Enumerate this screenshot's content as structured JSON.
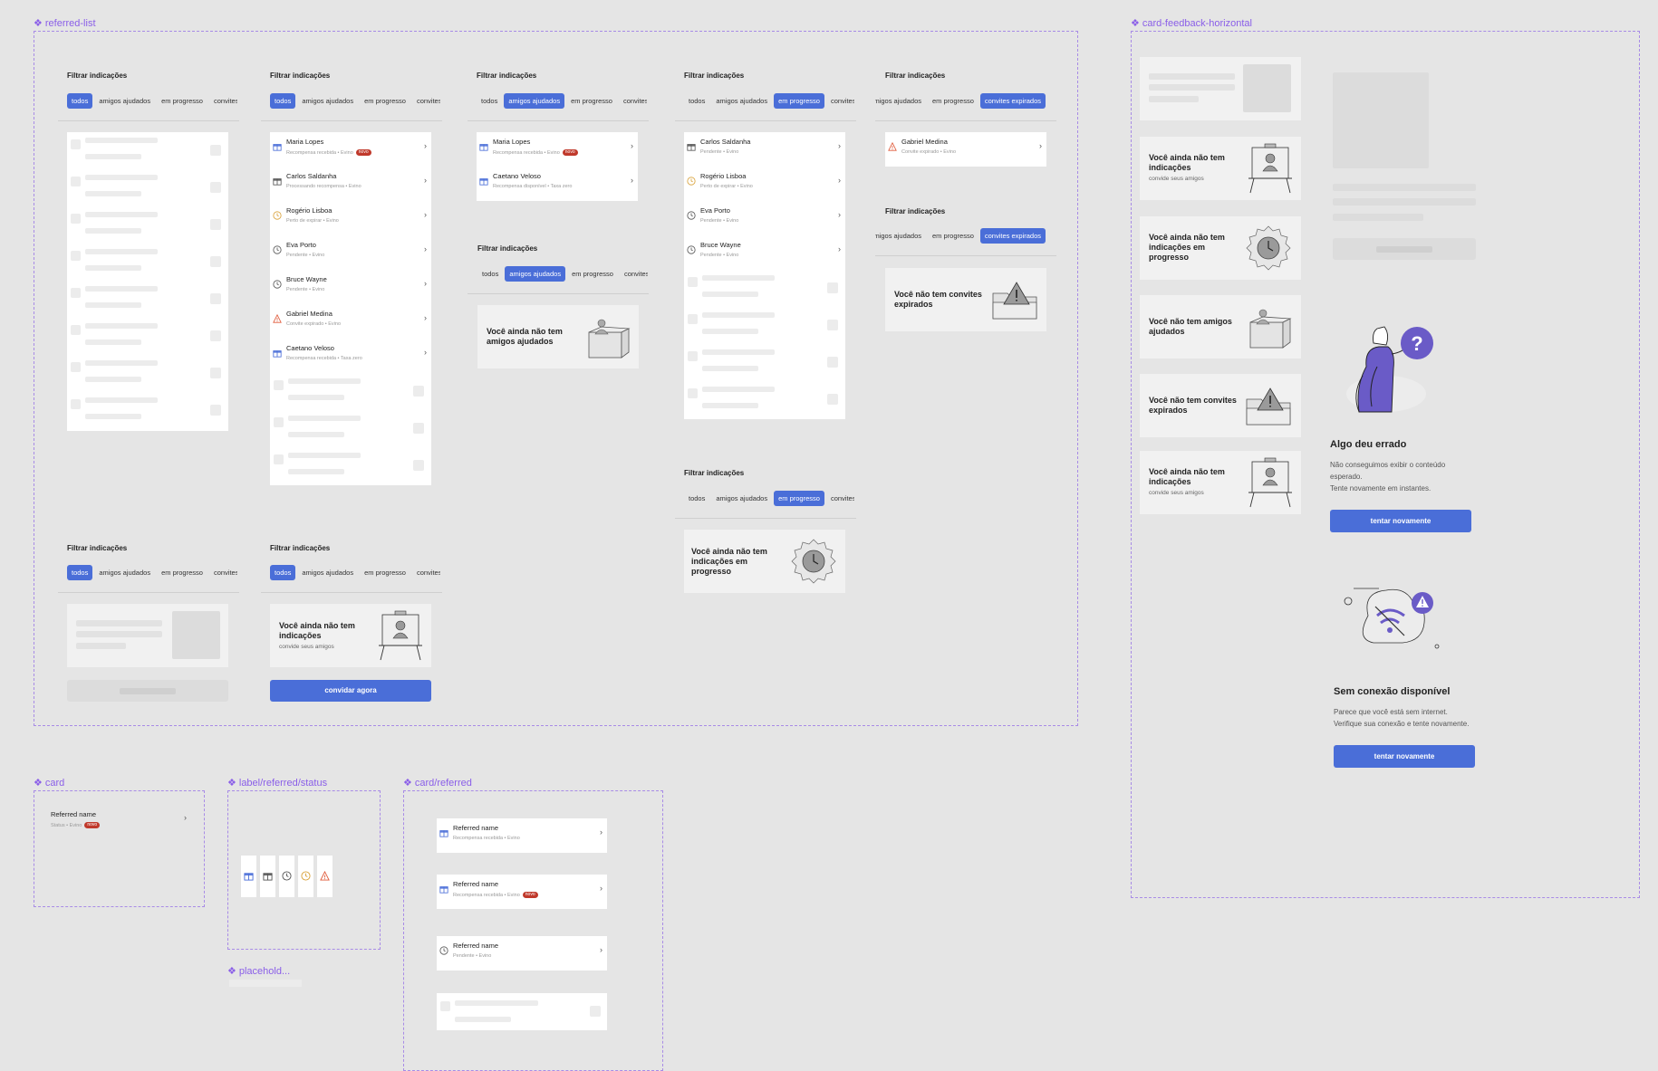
{
  "frames": {
    "referred_list": "referred-list",
    "card_feedback": "card-feedback-horizontal",
    "card": "card",
    "label_status": "label/referred/status",
    "placeholder": "placehold...",
    "card_referred": "card/referred"
  },
  "filter_header": "Filtrar indicações",
  "chips": {
    "todos": "todos",
    "amigos": "amigos ajudados",
    "progresso": "em progresso",
    "convites": "convites expirados",
    "convites_cut": "convites e",
    "amigos_cut": "amigos ajudados"
  },
  "badge": "novo",
  "list_todos": [
    {
      "name": "Maria Lopes",
      "sub": "Recompensa recebida • Evino",
      "badge": true,
      "icon": "gift-blue"
    },
    {
      "name": "Carlos Saldanha",
      "sub": "Processando recompensa • Evino",
      "badge": false,
      "icon": "gift-grey"
    },
    {
      "name": "Rogério Lisboa",
      "sub": "Perto de expirar • Evino",
      "badge": false,
      "icon": "clock-orange"
    },
    {
      "name": "Eva Porto",
      "sub": "Pendente • Evino",
      "badge": false,
      "icon": "clock"
    },
    {
      "name": "Bruce Wayne",
      "sub": "Pendente • Evino",
      "badge": false,
      "icon": "clock"
    },
    {
      "name": "Gabriel Medina",
      "sub": "Convite expirado • Evino",
      "badge": false,
      "icon": "warning"
    },
    {
      "name": "Caetano Veloso",
      "sub": "Recompensa recebida • Taxa zero",
      "badge": false,
      "icon": "gift-blue"
    }
  ],
  "list_amigos": [
    {
      "name": "Maria Lopes",
      "sub": "Recompensa recebida • Evino",
      "badge": true,
      "icon": "gift-blue"
    },
    {
      "name": "Caetano Veloso",
      "sub": "Recompensa disponível • Taxa zero",
      "badge": false,
      "icon": "gift-blue"
    }
  ],
  "list_progresso": [
    {
      "name": "Carlos Saldanha",
      "sub": "Pendente • Evino",
      "badge": false,
      "icon": "gift-grey"
    },
    {
      "name": "Rogério Lisboa",
      "sub": "Perto de expirar • Evino",
      "badge": false,
      "icon": "clock-orange"
    },
    {
      "name": "Eva Porto",
      "sub": "Pendente • Evino",
      "badge": false,
      "icon": "clock"
    },
    {
      "name": "Bruce Wayne",
      "sub": "Pendente • Evino",
      "badge": false,
      "icon": "clock"
    }
  ],
  "list_expirados": [
    {
      "name": "Gabriel Medina",
      "sub": "Convite expirado • Evino",
      "badge": false,
      "icon": "warning"
    }
  ],
  "empty": {
    "amigos": "Você ainda não tem amigos ajudados",
    "progresso": "Você ainda não tem indicações em progresso",
    "expirados": "Você não tem convites expirados",
    "indicacoes": "Você ainda não tem indicações",
    "indicacoes_sub": "convide seus amigos",
    "amigos_short": "Você não tem amigos ajudados",
    "convidar": "convidar agora"
  },
  "error": {
    "title": "Algo deu errado",
    "line1": "Não conseguimos exibir o conteúdo",
    "line2": "esperado.",
    "line3": "Tente novamente em instantes.",
    "button": "tentar novamente"
  },
  "offline": {
    "title": "Sem conexão disponível",
    "line1": "Parece que você está sem internet.",
    "line2": "Verifique sua conexão e tente novamente.",
    "button": "tentar novamente"
  },
  "card_demo": {
    "name": "Referred name",
    "sub": "Status • Evino"
  },
  "card_referred": [
    {
      "name": "Referred name",
      "sub": "Recompensa recebida • Evino",
      "badge": false,
      "icon": "gift-blue"
    },
    {
      "name": "Referred name",
      "sub": "Recompensa recebida • Evino",
      "badge": true,
      "icon": "gift-blue"
    },
    {
      "name": "Referred name",
      "sub": "Pendente • Evino",
      "badge": false,
      "icon": "clock"
    }
  ],
  "colors": {
    "accent": "#4a6ed8",
    "frame": "#a88be6",
    "badge": "#c0392b",
    "warning": "#e05a3a",
    "clock_orange": "#d9a23a"
  }
}
